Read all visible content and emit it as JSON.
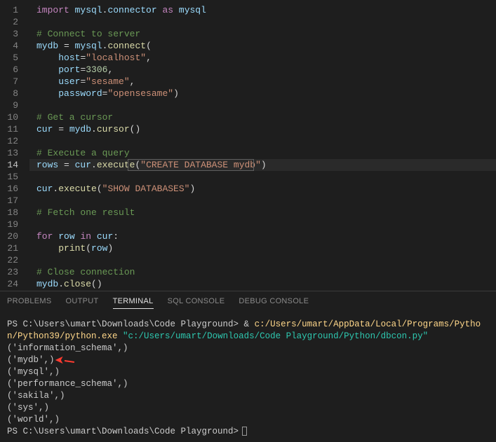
{
  "code": {
    "line_count": 24,
    "active_line": 14,
    "tokens": [
      [
        {
          "c": "kw",
          "t": "import"
        },
        {
          "c": "pn",
          "t": " "
        },
        {
          "c": "id",
          "t": "mysql"
        },
        {
          "c": "pn",
          "t": "."
        },
        {
          "c": "id",
          "t": "connector"
        },
        {
          "c": "pn",
          "t": " "
        },
        {
          "c": "kw",
          "t": "as"
        },
        {
          "c": "pn",
          "t": " "
        },
        {
          "c": "id",
          "t": "mysql"
        }
      ],
      [],
      [
        {
          "c": "cm",
          "t": "# Connect to server"
        }
      ],
      [
        {
          "c": "id",
          "t": "mydb"
        },
        {
          "c": "pn",
          "t": " = "
        },
        {
          "c": "id",
          "t": "mysql"
        },
        {
          "c": "pn",
          "t": "."
        },
        {
          "c": "fn",
          "t": "connect"
        },
        {
          "c": "pn",
          "t": "("
        }
      ],
      [
        {
          "c": "pn",
          "t": "    "
        },
        {
          "c": "id",
          "t": "host"
        },
        {
          "c": "pn",
          "t": "="
        },
        {
          "c": "str",
          "t": "\"localhost\""
        },
        {
          "c": "pn",
          "t": ","
        }
      ],
      [
        {
          "c": "pn",
          "t": "    "
        },
        {
          "c": "id",
          "t": "port"
        },
        {
          "c": "pn",
          "t": "="
        },
        {
          "c": "num",
          "t": "3306"
        },
        {
          "c": "pn",
          "t": ","
        }
      ],
      [
        {
          "c": "pn",
          "t": "    "
        },
        {
          "c": "id",
          "t": "user"
        },
        {
          "c": "pn",
          "t": "="
        },
        {
          "c": "str",
          "t": "\"sesame\""
        },
        {
          "c": "pn",
          "t": ","
        }
      ],
      [
        {
          "c": "pn",
          "t": "    "
        },
        {
          "c": "id",
          "t": "password"
        },
        {
          "c": "pn",
          "t": "="
        },
        {
          "c": "str",
          "t": "\"opensesame\""
        },
        {
          "c": "pn",
          "t": ")"
        }
      ],
      [],
      [
        {
          "c": "cm",
          "t": "# Get a cursor"
        }
      ],
      [
        {
          "c": "id",
          "t": "cur"
        },
        {
          "c": "pn",
          "t": " = "
        },
        {
          "c": "id",
          "t": "mydb"
        },
        {
          "c": "pn",
          "t": "."
        },
        {
          "c": "fn",
          "t": "cursor"
        },
        {
          "c": "pn",
          "t": "()"
        }
      ],
      [],
      [
        {
          "c": "cm",
          "t": "# Execute a query"
        }
      ],
      [
        {
          "c": "id",
          "t": "rows"
        },
        {
          "c": "pn",
          "t": " = "
        },
        {
          "c": "id",
          "t": "cur"
        },
        {
          "c": "pn",
          "t": "."
        },
        {
          "c": "fn",
          "t": "execute"
        },
        {
          "c": "pn",
          "t": "("
        },
        {
          "c": "str",
          "t": "\"CREATE DATABASE mydb\""
        },
        {
          "c": "pn",
          "t": ")"
        }
      ],
      [],
      [
        {
          "c": "id",
          "t": "cur"
        },
        {
          "c": "pn",
          "t": "."
        },
        {
          "c": "fn",
          "t": "execute"
        },
        {
          "c": "pn",
          "t": "("
        },
        {
          "c": "str",
          "t": "\"SHOW DATABASES\""
        },
        {
          "c": "pn",
          "t": ")"
        }
      ],
      [],
      [
        {
          "c": "cm",
          "t": "# Fetch one result"
        }
      ],
      [],
      [
        {
          "c": "ctl",
          "t": "for"
        },
        {
          "c": "pn",
          "t": " "
        },
        {
          "c": "id",
          "t": "row"
        },
        {
          "c": "pn",
          "t": " "
        },
        {
          "c": "ctl",
          "t": "in"
        },
        {
          "c": "pn",
          "t": " "
        },
        {
          "c": "id",
          "t": "cur"
        },
        {
          "c": "pn",
          "t": ":"
        }
      ],
      [
        {
          "c": "pn",
          "t": "    "
        },
        {
          "c": "fn",
          "t": "print"
        },
        {
          "c": "pn",
          "t": "("
        },
        {
          "c": "id",
          "t": "row"
        },
        {
          "c": "pn",
          "t": ")"
        }
      ],
      [],
      [
        {
          "c": "cm",
          "t": "# Close connection"
        }
      ],
      [
        {
          "c": "id",
          "t": "mydb"
        },
        {
          "c": "pn",
          "t": "."
        },
        {
          "c": "fn",
          "t": "close"
        },
        {
          "c": "pn",
          "t": "()"
        }
      ]
    ]
  },
  "panel": {
    "tabs": [
      "PROBLEMS",
      "OUTPUT",
      "TERMINAL",
      "SQL CONSOLE",
      "DEBUG CONSOLE"
    ],
    "active_tab": 2
  },
  "terminal": {
    "prompt1_prefix": "PS C:\\Users\\umart\\Downloads\\Code Playground> & ",
    "py_path": "c:/Users/umart/AppData/Local/Programs/Python/Python39/python.exe",
    "py_arg": "\"c:/Users/umart/Downloads/Code Playground/Python/dbcon.py\"",
    "output": [
      "('information_schema',)",
      "('mydb',)",
      "('mysql',)",
      "('performance_schema',)",
      "('sakila',)",
      "('sys',)",
      "('world',)"
    ],
    "prompt2": "PS C:\\Users\\umart\\Downloads\\Code Playground>"
  },
  "annotation": {
    "arrow_target_line": 1
  }
}
